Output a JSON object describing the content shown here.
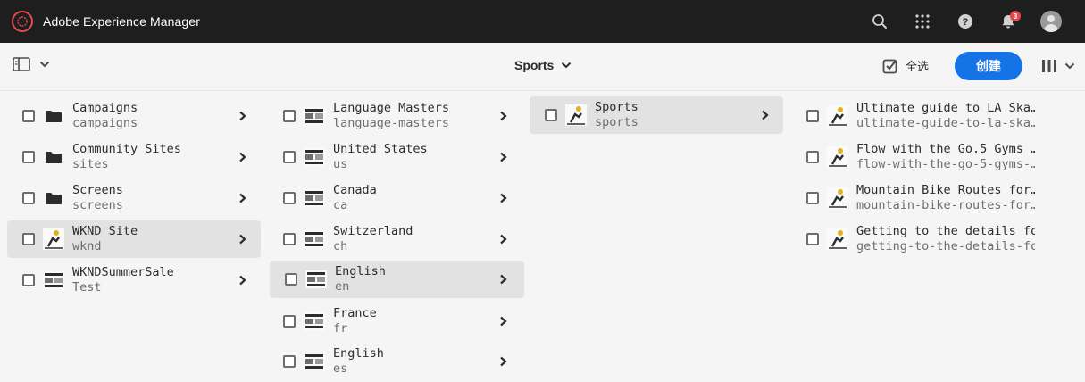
{
  "shell": {
    "app_title": "Adobe Experience Manager",
    "notification_count": "3",
    "icons": [
      "adobe-logo-icon",
      "search-icon",
      "apps-grid-icon",
      "help-icon",
      "bell-icon",
      "user-avatar-icon"
    ],
    "accent_color": "#e34850"
  },
  "actionbar": {
    "breadcrumb_label": "Sports",
    "select_all_label": "全选",
    "create_label": "创建",
    "create_color": "#1473e6"
  },
  "columns": [
    {
      "items": [
        {
          "title": "Campaigns",
          "name": "campaigns",
          "thumb": "folder"
        },
        {
          "title": "Community Sites",
          "name": "sites",
          "thumb": "folder"
        },
        {
          "title": "Screens",
          "name": "screens",
          "thumb": "folder"
        },
        {
          "title": "WKND Site",
          "name": "wknd",
          "thumb": "page",
          "active": true
        },
        {
          "title": "WKNDSummerSale",
          "name": "Test",
          "thumb": "page"
        }
      ]
    },
    {
      "items": [
        {
          "title": "Language Masters",
          "name": "language-masters",
          "thumb": "page"
        },
        {
          "title": "United States",
          "name": "us",
          "thumb": "page"
        },
        {
          "title": "Canada",
          "name": "ca",
          "thumb": "page"
        },
        {
          "title": "Switzerland",
          "name": "ch",
          "thumb": "page"
        },
        {
          "title": "English",
          "name": "en",
          "thumb": "page",
          "active": true
        },
        {
          "title": "France",
          "name": "fr",
          "thumb": "page"
        },
        {
          "title": "English",
          "name": "es",
          "thumb": "page"
        }
      ]
    },
    {
      "items": [
        {
          "title": "Sports",
          "name": "sports",
          "thumb": "article",
          "active": true
        }
      ]
    },
    {
      "items": [
        {
          "title": "Ultimate guide to LA Ska…",
          "name": "ultimate-guide-to-la-ska…",
          "thumb": "article"
        },
        {
          "title": "Flow with the Go.5 Gyms …",
          "name": "flow-with-the-go-5-gyms-…",
          "thumb": "article"
        },
        {
          "title": "Mountain Bike Routes for…",
          "name": "mountain-bike-routes-for…",
          "thumb": "article"
        },
        {
          "title": "Getting to the details for",
          "name": "getting-to-the-details-for",
          "thumb": "article"
        }
      ]
    }
  ]
}
